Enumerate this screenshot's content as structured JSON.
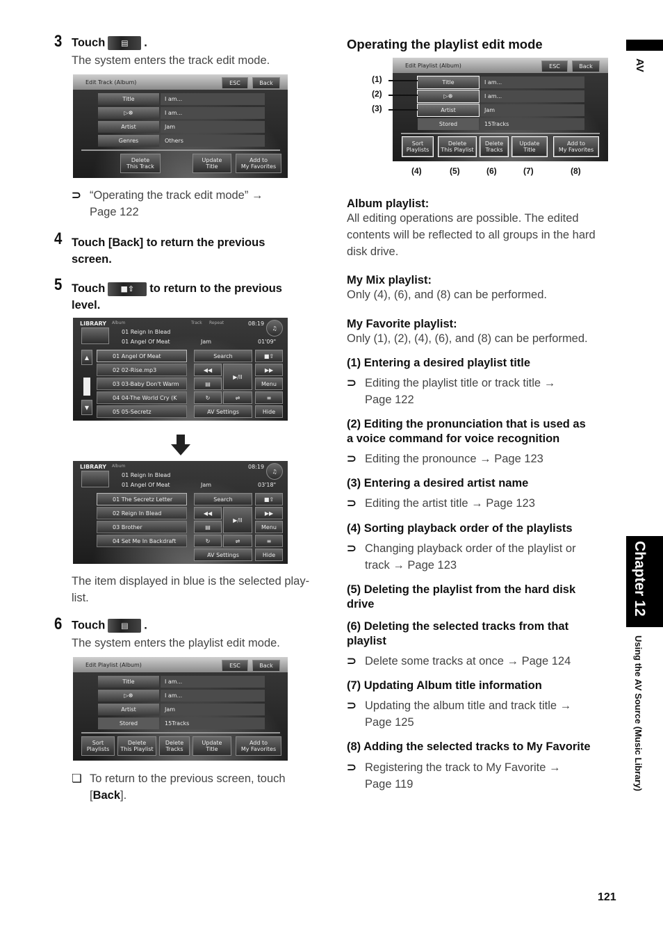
{
  "left_column": {
    "step3": {
      "number": "3",
      "instruction_prefix": "Touch",
      "button_icon": "edit-list-icon",
      "instruction_suffix": ".",
      "description": "The system enters the track edit mode.",
      "screen": {
        "title": "Edit Track (Album)",
        "esc": "ESC",
        "back": "Back",
        "fields": [
          {
            "label": "Title",
            "value": "I am..."
          },
          {
            "label": "▷☸",
            "value": "I am..."
          },
          {
            "label": "Artist",
            "value": "Jam"
          },
          {
            "label": "Genres",
            "value": "Others"
          }
        ],
        "buttons": [
          {
            "line1": "Delete",
            "line2": "This Track"
          },
          {
            "line1": "Update",
            "line2": "Title"
          },
          {
            "line1": "Add to",
            "line2": "My Favorites"
          }
        ]
      },
      "reference": {
        "text": "“Operating the track edit mode” →",
        "page": "Page 122"
      }
    },
    "step4": {
      "number": "4",
      "instruction_line1": "Touch [Back] to return the previous",
      "instruction_line2": "screen."
    },
    "step5": {
      "number": "5",
      "instruction_prefix": "Touch",
      "button_icon": "folder-up-icon",
      "instruction_suffix_line1": "to return to the previous",
      "instruction_line2": "level.",
      "screen_before": {
        "header": "LIBRARY",
        "header_sub": "Album",
        "header_mid1": "Track",
        "header_mid2": "Repeat",
        "clock": "08:19",
        "now_album": "01 Reign In Blead",
        "now_track": "01 Angel Of Meat",
        "artist": "Jam",
        "time": "01'09\"",
        "items": [
          "01 Angel Of Meat",
          "02 02-Rise.mp3",
          "03 03-Baby Don't Warm",
          "04 04-The World Cry (K",
          "05 05-Secretz"
        ],
        "controls": {
          "search": "Search",
          "play_pause": "▶/II",
          "menu": "Menu",
          "av_settings": "AV Settings",
          "hide": "Hide"
        }
      },
      "arrow_icon": "down-arrow-icon",
      "screen_after": {
        "header": "LIBRARY",
        "header_sub": "Album",
        "clock": "08:19",
        "now_album": "01 Reign In Blead",
        "now_track": "01 Angel Of Meat",
        "artist": "Jam",
        "time": "03'18\"",
        "items": [
          "01 The Secretz Letter",
          "02 Reign In Blead",
          "03 Brother",
          "04 Set Me In Backdraft"
        ],
        "controls": {
          "search": "Search",
          "play_pause": "▶/II",
          "menu": "Menu",
          "av_settings": "AV Settings",
          "hide": "Hide"
        }
      },
      "note_line1": "The item displayed in blue is the selected play-",
      "note_line2": "list."
    },
    "step6": {
      "number": "6",
      "instruction_prefix": "Touch",
      "button_icon": "edit-list-icon",
      "instruction_suffix": ".",
      "description": "The system enters the playlist edit mode.",
      "screen": {
        "title": "Edit Playlist (Album)",
        "esc": "ESC",
        "back": "Back",
        "fields": [
          {
            "label": "Title",
            "value": "I am..."
          },
          {
            "label": "▷☸",
            "value": "I am..."
          },
          {
            "label": "Artist",
            "value": "Jam"
          },
          {
            "label": "Stored",
            "value": "15Tracks"
          }
        ],
        "buttons": [
          {
            "line1": "Sort",
            "line2": "Playlists"
          },
          {
            "line1": "Delete",
            "line2": "This Playlist"
          },
          {
            "line1": "Delete",
            "line2": "Tracks"
          },
          {
            "line1": "Update",
            "line2": "Title"
          },
          {
            "line1": "Add to",
            "line2": "My Favorites"
          }
        ]
      },
      "note_prefix": "To return to the previous screen, touch",
      "note_open": "[",
      "note_bold": "Back",
      "note_close": "]."
    }
  },
  "right_column": {
    "heading": "Operating the playlist edit mode",
    "diagram": {
      "callouts_left": [
        "(1)",
        "(2)",
        "(3)"
      ],
      "callouts_bottom": [
        "(4)",
        "(5)",
        "(6)",
        "(7)",
        "(8)"
      ]
    },
    "playlist_types": [
      {
        "title": "Album playlist:",
        "lines": [
          "All editing operations are possible. The edited",
          "contents will be reflected to all groups in the hard",
          "disk drive."
        ]
      },
      {
        "title": "My Mix playlist:",
        "lines": [
          "Only (4), (6), and (8) can be performed."
        ]
      },
      {
        "title": "My Favorite playlist:",
        "lines": [
          "Only (1), (2), (4), (6), and (8) can be performed."
        ]
      }
    ],
    "items": [
      {
        "title": [
          "(1) Entering a desired playlist title"
        ],
        "ref": [
          "Editing the playlist title or track title →",
          "Page 122"
        ]
      },
      {
        "title": [
          "(2) Editing the pronunciation that is used as",
          "a voice command for voice recognition"
        ],
        "ref": [
          "Editing the pronounce → Page 123"
        ]
      },
      {
        "title": [
          "(3) Entering a desired artist name"
        ],
        "ref": [
          "Editing the artist title → Page 123"
        ]
      },
      {
        "title": [
          "(4) Sorting playback order of the playlists"
        ],
        "ref": [
          "Changing playback order of the playlist or",
          "track → Page 123"
        ]
      },
      {
        "title": [
          "(5) Deleting the playlist from the hard disk",
          "drive"
        ],
        "ref": []
      },
      {
        "title": [
          "(6) Deleting the selected tracks from that",
          "playlist"
        ],
        "ref": [
          "Delete some tracks at once → Page 124"
        ]
      },
      {
        "title": [
          "(7) Updating Album title information"
        ],
        "ref": [
          "Updating the album title and track title →",
          "Page 125"
        ]
      },
      {
        "title": [
          "(8) Adding the selected tracks to My Favorite"
        ],
        "ref": [
          "Registering the track to My Favorite →",
          "Page 119"
        ]
      }
    ],
    "ref_mark": "⊃"
  },
  "side_tabs": {
    "section": "AV",
    "chapter": "Chapter 12",
    "chapter_title": "Using the AV Source (Music Library)"
  },
  "page_number": "121",
  "note_mark": "❏"
}
